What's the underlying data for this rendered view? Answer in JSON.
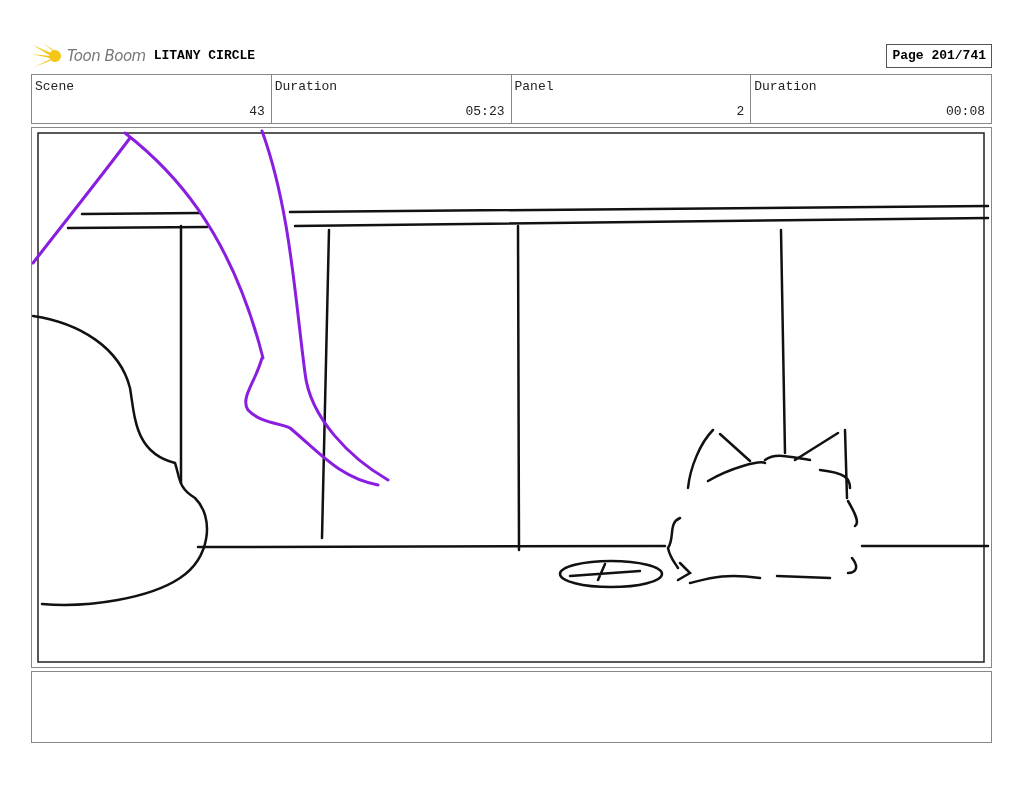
{
  "header": {
    "logo_text": "Toon Boom",
    "project_title": "LITANY CIRCLE",
    "page": "Page 201/741"
  },
  "info_columns": [
    {
      "heading": "Scene",
      "entry": "43"
    },
    {
      "heading": "Duration",
      "entry": "05:23"
    },
    {
      "heading": "Panel",
      "entry": "2"
    },
    {
      "heading": "Duration",
      "entry": "00:08"
    }
  ]
}
